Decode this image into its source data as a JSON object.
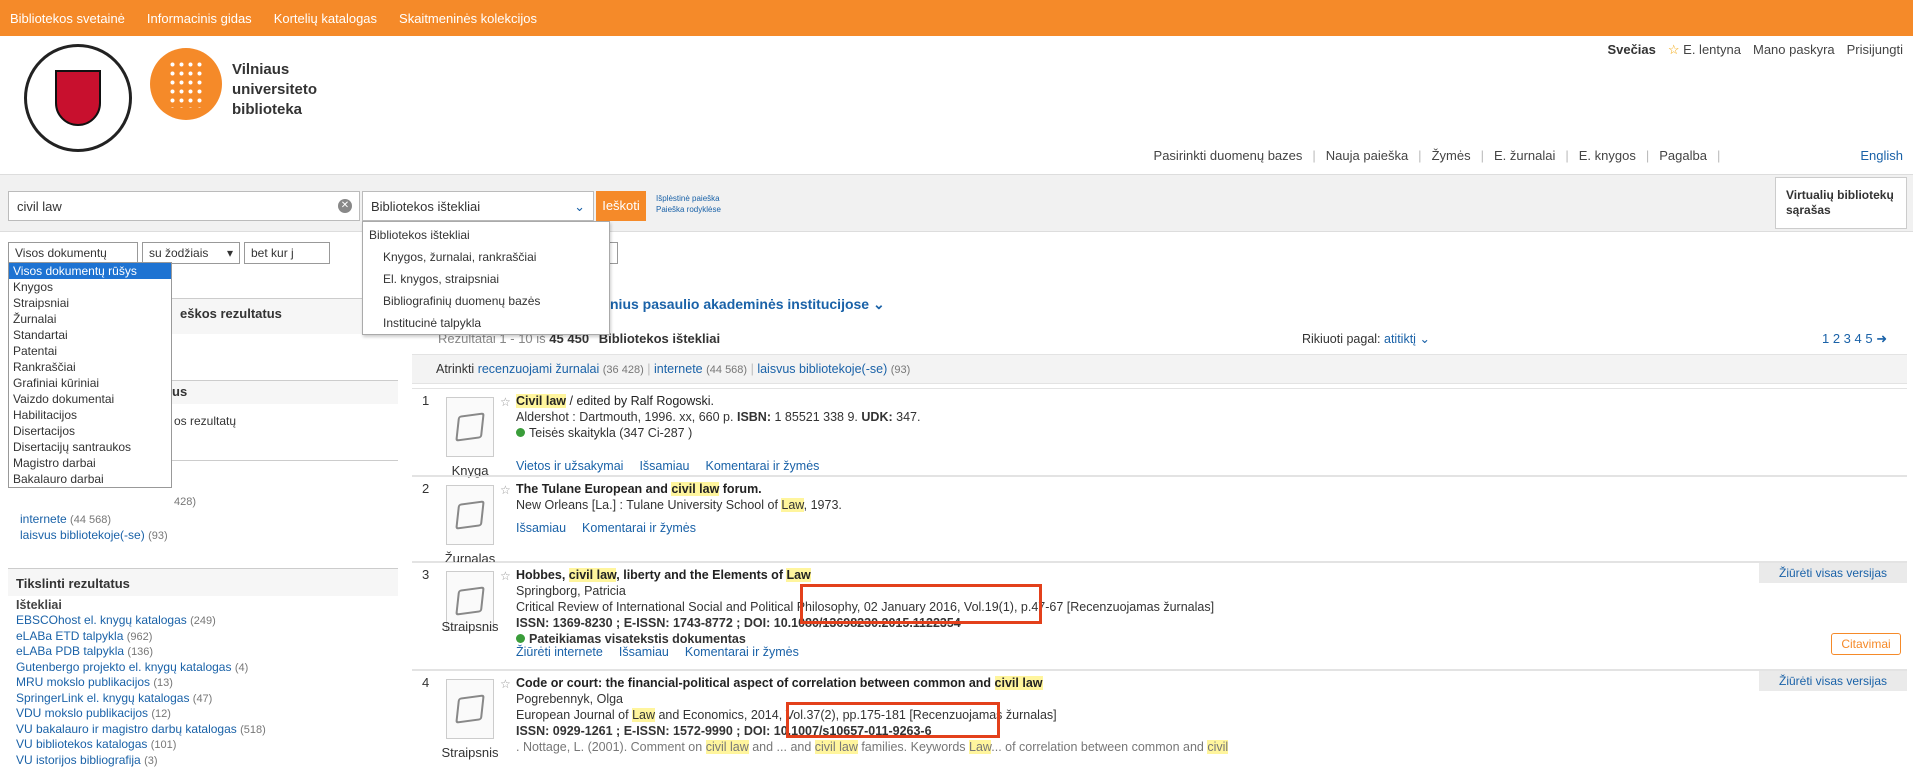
{
  "topnav": [
    "Bibliotekos svetainė",
    "Informacinis gidas",
    "Kortelių katalogas",
    "Skaitmeninės kolekcijos"
  ],
  "user": {
    "guest": "Svečias",
    "eshelf": "E. lentyna",
    "account": "Mano paskyra",
    "login": "Prisijungti"
  },
  "logo": {
    "line1": "Vilniaus",
    "line2": "universiteto",
    "line3": "biblioteka"
  },
  "nav": {
    "databases": "Pasirinkti duomenų bazes",
    "new_search": "Nauja paieška",
    "tags": "Žymės",
    "ejournals": "E. žurnalai",
    "ebooks": "E. knygos",
    "help": "Pagalba",
    "language": "English"
  },
  "search": {
    "query": "civil law",
    "scope": "Bibliotekos ištekliai",
    "button": "Ieškoti",
    "advanced": "Išplėstinė paieška",
    "in_indexes": "Paieška rodyklėse",
    "virtual_list": "Virtualių bibliotekų sąrašas"
  },
  "filters": {
    "doctype": "Visos dokumentų rūšys",
    "words": "su žodžiais",
    "where": "bet kur j"
  },
  "doctype_options": [
    "Visos dokumentų rūšys",
    "Knygos",
    "Straipsniai",
    "Žurnalai",
    "Standartai",
    "Patentai",
    "Rankraščiai",
    "Grafiniai kūriniai",
    "Vaizdo dokumentai",
    "Habilitacijos",
    "Disertacijos",
    "Disertacijų santraukos",
    "Magistro darbai",
    "Bakalauro darbai"
  ],
  "scope_options": {
    "header": "Bibliotekos ištekliai",
    "items": [
      "Knygos, žurnalai, rankraščiai",
      "El. knygos, straipsniai",
      "Bibliografinių duomenų bazės",
      "Institucinė talpykla"
    ]
  },
  "sidebar": {
    "partial1": "eškos rezultatus",
    "partial2": "us",
    "partial3": "os rezultatų",
    "count_partial": "428)",
    "links": [
      {
        "label": "internete",
        "count": "(44 568)"
      },
      {
        "label": "laisvus bibliotekoje(-se)",
        "count": "(93)"
      }
    ],
    "refine_title": "Tikslinti rezultatus",
    "sources_title": "Ištekliai",
    "sources": [
      {
        "label": "EBSCOhost el. knygų katalogas",
        "count": "(249)"
      },
      {
        "label": "eLABa ETD talpykla",
        "count": "(962)"
      },
      {
        "label": "eLABa PDB talpykla",
        "count": "(136)"
      },
      {
        "label": "Gutenbergo projekto el. knygų katalogas",
        "count": "(4)"
      },
      {
        "label": "MRU mokslo publikacijos",
        "count": "(13)"
      },
      {
        "label": "SpringerLink el. knygų katalogas",
        "count": "(47)"
      },
      {
        "label": "VDU mokslo publikacijos",
        "count": "(12)"
      },
      {
        "label": "VU bakalauro ir magistro darbų katalogas",
        "count": "(518)"
      },
      {
        "label": "VU bibliotekos katalogas",
        "count": "(101)"
      },
      {
        "label": "VU istorijos bibliografija",
        "count": "(3)"
      }
    ]
  },
  "results_header": {
    "institutions": "nius pasaulio akademinės institucijose",
    "summary_prefix": "Rezultatai 1 - 10 iš",
    "total": "45 450",
    "source": "Bibliotekos ištekliai",
    "sort_label": "Rikiuoti pagal:",
    "sort_value": "atitiktį",
    "pages": "1 2 3 4 5",
    "next": "➜",
    "refine_label": "Atrinkti",
    "refine_links": [
      {
        "label": "recenzuojami žurnalai",
        "count": "(36 428)"
      },
      {
        "label": "internete",
        "count": "(44 568)"
      },
      {
        "label": "laisvus bibliotekoje(-se)",
        "count": "(93)"
      }
    ]
  },
  "results": [
    {
      "num": "1",
      "type": "Knyga",
      "title_hl": "Civil law",
      "title_rest": " / edited by Ralf Rogowski.",
      "line2": "Aldershot : Dartmouth, 1996. xx, 660 p.",
      "isbn_label": "ISBN:",
      "isbn": "1 85521 338 9.",
      "udk_label": "UDK:",
      "udk": "347.",
      "avail": "Teisės skaitykla  (347 Ci-287 )",
      "actions": [
        "Vietos ir užsakymai",
        "Išsamiau",
        "Komentarai ir žymės"
      ]
    },
    {
      "num": "2",
      "type": "Žurnalas",
      "title_a": "The Tulane European and ",
      "title_hl": "civil law",
      "title_b": " forum.",
      "line2a": "New Orleans [La.] : Tulane University School of ",
      "line2hl": "Law",
      "line2b": ", 1973.",
      "actions": [
        "Išsamiau",
        "Komentarai ir žymės"
      ]
    },
    {
      "num": "3",
      "type": "Straipsnis",
      "title_a": "Hobbes, ",
      "title_hl": "civil law",
      "title_b": ", liberty and the Elements of ",
      "title_hl2": "Law",
      "author": "Springborg, Patricia",
      "journal": "Critical Review of International Social and Political Philosophy, 02 January 2016, Vol.19(1), p.47-67 [Recenzuojamas žurnalas]",
      "ids": "ISSN: 1369-8230 ; E-ISSN: 1743-8772 ;",
      "doi": "DOI: 10.1080/13698230.2015.1122354",
      "fulltext": "Pateikiamas visatekstis dokumentas",
      "actions": [
        "Žiūrėti internete",
        "Išsamiau",
        "Komentarai ir žymės"
      ],
      "versions": "Žiūrėti visas versijas",
      "cite": "Citavimai"
    },
    {
      "num": "4",
      "type": "Straipsnis",
      "title_a": "Code or court: the financial-political aspect of correlation between common and ",
      "title_hl": "civil law",
      "author": "Pogrebennyk, Olga",
      "journal_a": "European Journal of ",
      "journal_hl": "Law",
      "journal_b": " and Economics, 2014, Vol.37(2), pp.175-181 [Recenzuojamas žurnalas]",
      "ids": "ISSN: 0929-1261 ; E-ISSN: 1572-9990 ;",
      "doi": "DOI: 10.1007/s10657-011-9263-6",
      "snippet_a": ". Nottage, L. (2001). Comment on ",
      "snippet_hl": "civil law",
      "snippet_b": " and ... and ",
      "snippet_hl2": "civil law",
      "snippet_c": " families. Keywords ",
      "snippet_hl3": "Law",
      "snippet_d": "... of correlation between common and ",
      "snippet_hl4": "civil",
      "versions": "Žiūrėti visas versijas"
    }
  ]
}
